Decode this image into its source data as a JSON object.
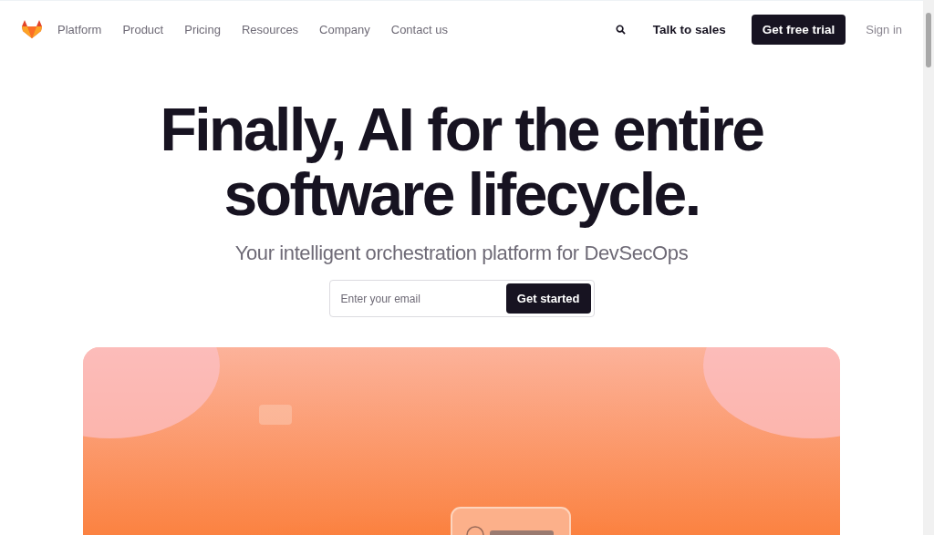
{
  "nav": {
    "links": [
      "Platform",
      "Product",
      "Pricing",
      "Resources",
      "Company",
      "Contact us"
    ],
    "talk_to_sales": "Talk to sales",
    "trial_button": "Get free trial",
    "sign_in": "Sign in"
  },
  "hero": {
    "title_lines": [
      "Finally, AI for the entire",
      "software lifecycle."
    ],
    "subtitle": "Your intelligent orchestration platform for DevSecOps",
    "email": {
      "placeholder": "Enter your email"
    },
    "cta": "Get started"
  }
}
